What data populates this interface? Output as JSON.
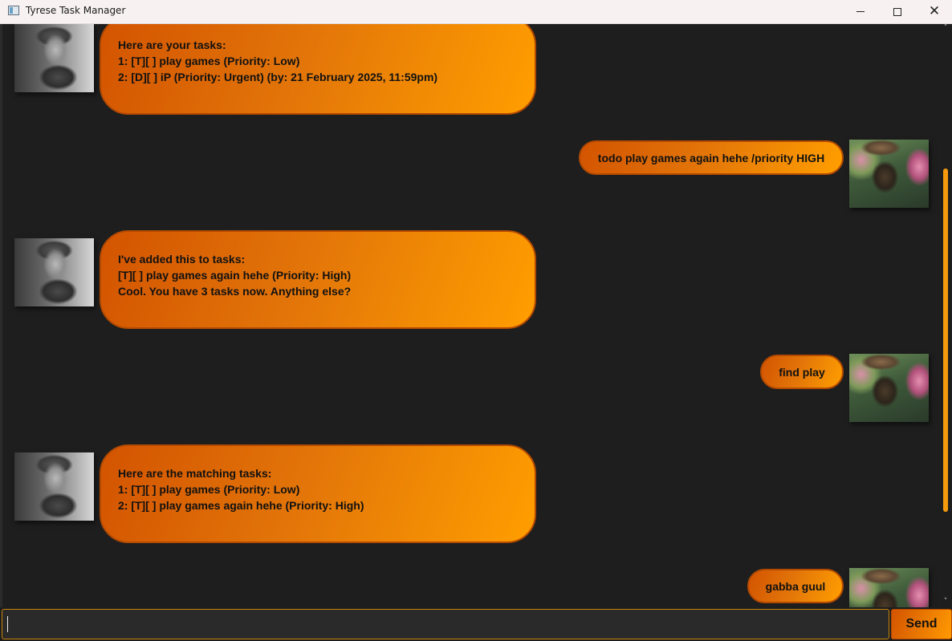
{
  "window": {
    "title": "Tyrese Task Manager",
    "minimize_icon": "minimize-icon",
    "maximize_icon": "maximize-icon",
    "close_icon": "close-icon",
    "close_glyph": "✕"
  },
  "messages": [
    {
      "sender": "duke",
      "divider_top": "________________________________________________________________________________________________________",
      "lines": [
        "Here are your tasks:",
        "1: [T][ ] play games (Priority: Low)",
        "2: [D][ ] iP (Priority: Urgent) (by: 21 February 2025, 11:59pm)"
      ],
      "divider_bottom": "________________________________________________________________________________________________________"
    },
    {
      "sender": "user",
      "text": "todo play games again hehe /priority HIGH"
    },
    {
      "sender": "duke",
      "divider_top": "________________________________________________________________________________________________________",
      "lines": [
        "I've added this to tasks:",
        "[T][ ] play games again hehe (Priority: High)",
        "Cool. You have 3 tasks now. Anything else?"
      ],
      "divider_bottom": "________________________________________________________________________________________________________"
    },
    {
      "sender": "user",
      "text": "find play"
    },
    {
      "sender": "duke",
      "divider_top": "________________________________________________________________________________________________________",
      "lines": [
        "Here are the matching tasks:",
        "1: [T][ ] play games (Priority: Low)",
        "2: [T][ ] play games again hehe (Priority: High)"
      ],
      "divider_bottom": "________________________________________________________________________________________________________"
    },
    {
      "sender": "user",
      "text": "gabba guul"
    }
  ],
  "scrollbar": {
    "up_glyph": "˄",
    "down_glyph": "˅"
  },
  "input": {
    "value": "",
    "placeholder": ""
  },
  "send_button": {
    "label": "Send"
  },
  "colors": {
    "accent_start": "#d35400",
    "accent_end": "#ff9e00",
    "background": "#1e1e1e"
  }
}
